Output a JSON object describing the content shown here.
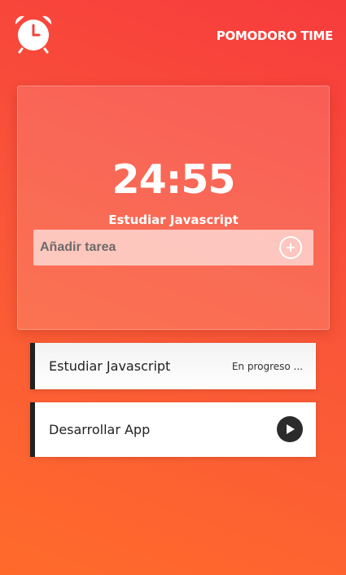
{
  "header": {
    "app_title": "POMODORO TIME",
    "logo_icon": "alarm-clock-icon"
  },
  "timer": {
    "display": "24:55",
    "current_task": "Estudiar Javascript"
  },
  "add_task": {
    "placeholder": "Añadir tarea",
    "value": "",
    "button_icon": "plus-circle-icon"
  },
  "tasks": [
    {
      "label": "Estudiar Javascript",
      "status": "En progreso ..."
    },
    {
      "label": "Desarrollar App",
      "action_icon": "play-icon"
    }
  ],
  "colors": {
    "background_top": "#f73c3c",
    "background_bottom": "#ff6b2b",
    "task_accent": "#222222"
  }
}
